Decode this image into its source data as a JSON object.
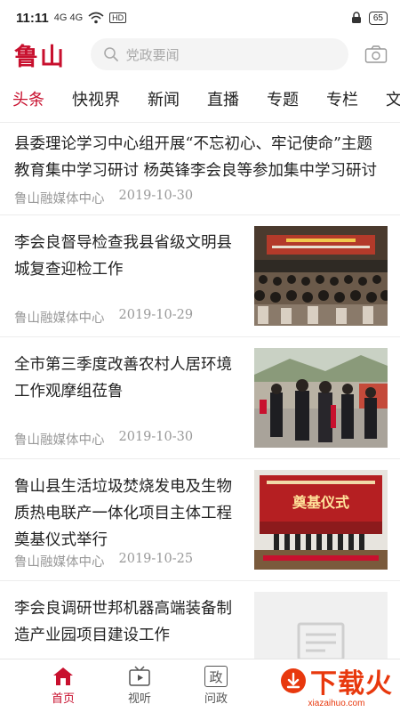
{
  "status": {
    "time": "11:11",
    "signal": "4G 4G",
    "network": "HD",
    "battery": "65"
  },
  "header": {
    "logo": "鲁山",
    "search_placeholder": "党政要闻"
  },
  "tabs": [
    {
      "label": "头条",
      "active": true
    },
    {
      "label": "快视界"
    },
    {
      "label": "新闻"
    },
    {
      "label": "直播"
    },
    {
      "label": "专题"
    },
    {
      "label": "专栏"
    },
    {
      "label": "文"
    }
  ],
  "news": [
    {
      "title": "县委理论学习中心组开展“不忘初心、牢记使命”主题教育集中学习研讨 杨英锋李会良等参加集中学习研讨",
      "source": "鲁山融媒体中心",
      "date": "2019-10-30"
    },
    {
      "title": "李会良督导检查我县省级文明县城复查迎检工作",
      "source": "鲁山融媒体中心",
      "date": "2019-10-29"
    },
    {
      "title": "全市第三季度改善农村人居环境工作观摩组莅鲁",
      "source": "鲁山融媒体中心",
      "date": "2019-10-30"
    },
    {
      "title": "鲁山县生活垃圾焚烧发电及生物质热电联产一体化项目主体工程奠基仪式举行",
      "source": "鲁山融媒体中心",
      "date": "2019-10-25",
      "banner_text": "奠基仪式"
    },
    {
      "title": "李会良调研世邦机器高端装备制造产业园项目建设工作"
    }
  ],
  "bottom_nav": [
    {
      "label": "首页",
      "icon": "home-icon",
      "active": true
    },
    {
      "label": "视听",
      "icon": "tv-icon"
    },
    {
      "label": "问政",
      "icon": "zheng-icon",
      "glyph": "政"
    }
  ],
  "watermark": {
    "text": "下载火",
    "domain": "xiazaihuo.com"
  },
  "colors": {
    "accent": "#c8102e",
    "meta": "#999999",
    "watermark": "#e8380d"
  }
}
